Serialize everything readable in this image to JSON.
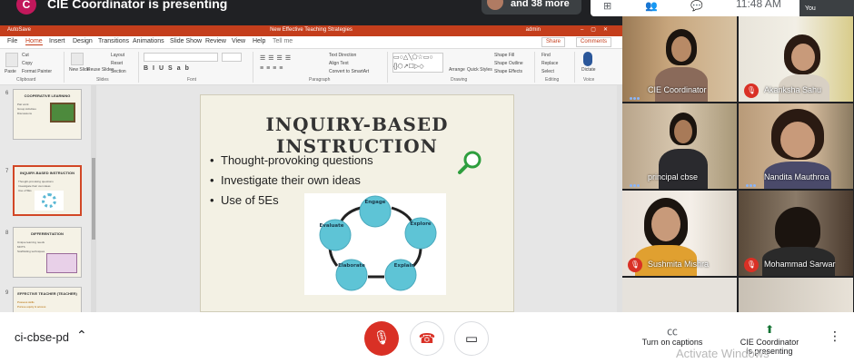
{
  "banner": {
    "avatar_letter": "C",
    "presenting_text": "CIE Coordinator is presenting",
    "more_count": "and 38 more"
  },
  "topbar": {
    "clock": "11:48 AM",
    "you_label": "You"
  },
  "ppt": {
    "window_title": "New Effective Teaching Strategies",
    "autosave": "AutoSave",
    "user": "admin",
    "menu_tabs": [
      "File",
      "Home",
      "Insert",
      "Design",
      "Transitions",
      "Animations",
      "Slide Show",
      "Review",
      "View",
      "Help",
      "Tell me"
    ],
    "active_tab": "Home",
    "share": "Share",
    "comments": "Comments",
    "ribbon": {
      "paste": "Paste",
      "cut": "Cut",
      "copy": "Copy",
      "format_painter": "Format Painter",
      "new_slide": "New Slide",
      "reuse_slides": "Reuse Slides",
      "layout": "Layout",
      "reset": "Reset",
      "section": "Section",
      "text_direction": "Text Direction",
      "align_text": "Align Text",
      "convert_smartart": "Convert to SmartArt",
      "arrange": "Arrange",
      "quick_styles": "Quick Styles",
      "shape_fill": "Shape Fill",
      "shape_outline": "Shape Outline",
      "shape_effects": "Shape Effects",
      "find": "Find",
      "replace": "Replace",
      "select": "Select",
      "dictate": "Dictate",
      "groups": [
        "Clipboard",
        "Slides",
        "Font",
        "Paragraph",
        "Drawing",
        "Editing",
        "Voice"
      ]
    },
    "thumbnails": [
      {
        "num": "6",
        "title": "COOPERATIVE LEARNING",
        "lines": [
          "Pair work",
          "Group Activities",
          "Discussions"
        ]
      },
      {
        "num": "7",
        "title": "INQUIRY-BASED INSTRUCTION",
        "lines": [
          "Thought-provoking questions",
          "Investigate their own ideas",
          "Use of 5Es"
        ]
      },
      {
        "num": "8",
        "title": "DIFFERENTIATION",
        "lines": [
          "Unique learning needs",
          "MOTS",
          "Scaffolding techniques"
        ]
      },
      {
        "num": "9",
        "title": "EFFECTIVE TEACHER (TEACHER)",
        "lines": [
          "Possess skills",
          "Pursue equity & access"
        ]
      }
    ],
    "slide": {
      "title": "INQUIRY-BASED INSTRUCTION",
      "bullets": [
        "Thought-provoking questions",
        "Investigate their own ideas",
        "Use of  5Es"
      ],
      "cycle": [
        "Engage",
        "Explore",
        "Explain",
        "Elaborate",
        "Evaluate"
      ]
    }
  },
  "participants": [
    {
      "name": "CIE Coordinator",
      "muted": false,
      "speaking": true
    },
    {
      "name": "Akanksha Sahu",
      "muted": true,
      "speaking": false
    },
    {
      "name": "principal cbse",
      "muted": false,
      "speaking": true
    },
    {
      "name": "Nandita Mauthroa",
      "muted": false,
      "speaking": true
    },
    {
      "name": "Sushmita Mishra",
      "muted": true,
      "speaking": false
    },
    {
      "name": "Mohammad Sarwar",
      "muted": true,
      "speaking": false
    }
  ],
  "bottombar": {
    "meeting_code": "ci-cbse-pd",
    "captions_label": "Turn on captions",
    "presenting_label_line1": "CIE Coordinator",
    "presenting_label_line2": "is presenting",
    "watermark": "Activate Windows"
  },
  "colors": {
    "ppt_accent": "#c43e1c",
    "meet_red": "#d93025",
    "slide_bg": "#f3f1e4"
  }
}
